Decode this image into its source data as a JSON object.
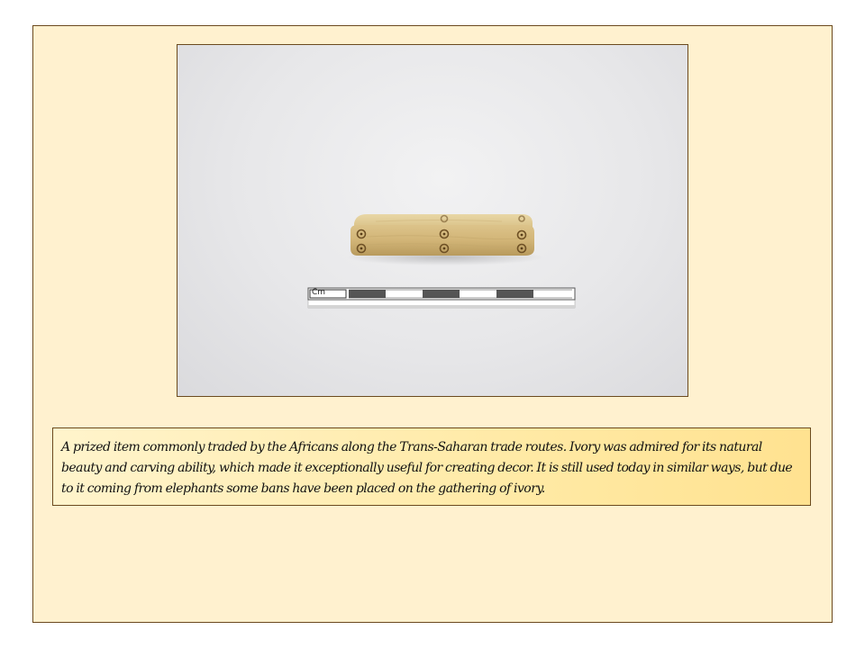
{
  "slide": {
    "background_color": "#fff1cf",
    "border_color": "#6b4a1e"
  },
  "photo": {
    "subject": "carved ivory bar with scale ruler",
    "scale_label": "Cm"
  },
  "caption": {
    "text": "A prized item commonly traded by the Africans along the Trans-Saharan trade routes. Ivory was admired for its natural beauty and carving ability, which made it exceptionally useful for creating decor. It is still used today in similar ways, but due to it coming from elephants some bans have been placed on the gathering of ivory."
  }
}
